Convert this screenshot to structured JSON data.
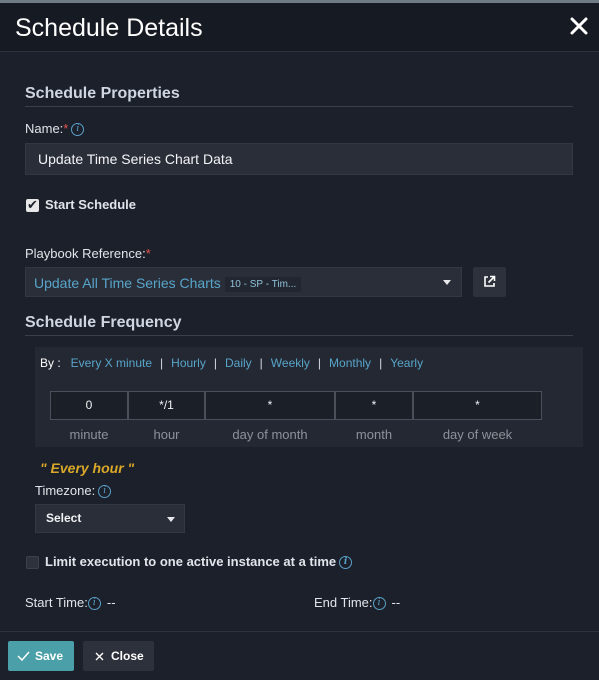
{
  "dialog": {
    "title": "Schedule Details"
  },
  "properties": {
    "section_title": "Schedule Properties",
    "name_label": "Name:",
    "required_mark": "*",
    "name_value": "Update Time Series Chart Data",
    "start_schedule_label": "Start Schedule",
    "start_schedule_checked": true,
    "playbook_label": "Playbook Reference:",
    "playbook_value": "Update All Time Series Charts",
    "playbook_tag": "10 - SP - Tim..."
  },
  "frequency": {
    "section_title": "Schedule Frequency",
    "by_label": "By :",
    "options": [
      "Every X minute",
      "Hourly",
      "Daily",
      "Weekly",
      "Monthly",
      "Yearly"
    ],
    "separator": "|",
    "cron": [
      {
        "value": "0",
        "label": "minute"
      },
      {
        "value": "*/1",
        "label": "hour"
      },
      {
        "value": "*",
        "label": "day of month"
      },
      {
        "value": "*",
        "label": "month"
      },
      {
        "value": "*",
        "label": "day of week"
      }
    ],
    "summary": "\" Every hour \"",
    "timezone_label": "Timezone:",
    "timezone_value": "Select"
  },
  "limit": {
    "label": "Limit execution to one active instance at a time",
    "checked": false
  },
  "times": {
    "start_label": "Start Time:",
    "start_value": "--",
    "end_label": "End Time:",
    "end_value": "--"
  },
  "footer": {
    "save_label": "Save",
    "close_label": "Close"
  },
  "colors": {
    "accent": "#4a9fa9",
    "link": "#58a5ca",
    "summary": "#d9a828",
    "required": "#e2534b"
  },
  "icons": {
    "close": "close-icon",
    "info": "info-icon",
    "external": "external-link-icon",
    "check": "check-icon"
  }
}
